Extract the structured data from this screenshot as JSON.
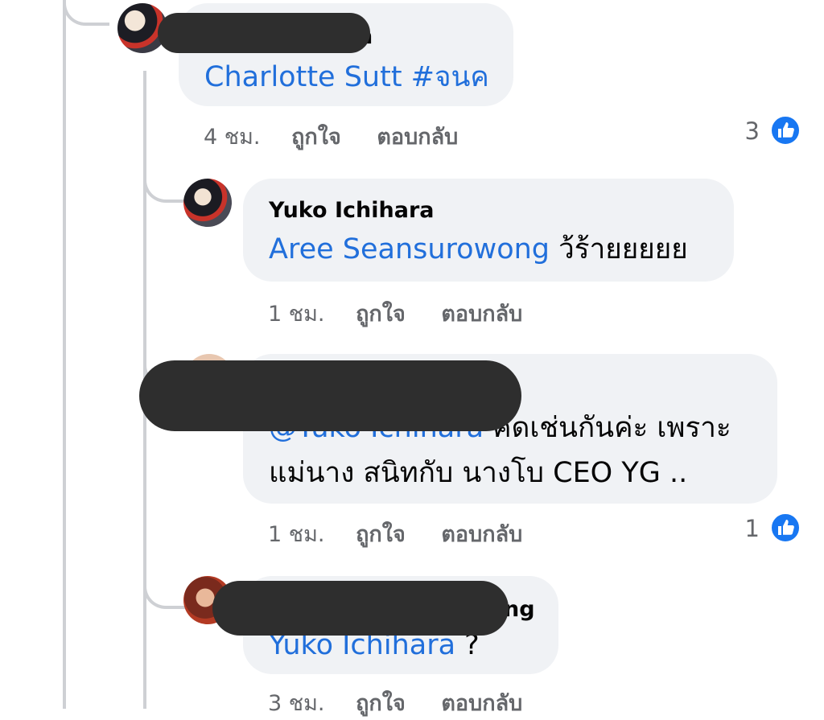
{
  "comments": [
    {
      "time": "4 ชม.",
      "like_label": "ถูกใจ",
      "reply_label": "ตอบกลับ",
      "author_visible": "n",
      "mention": "Charlotte Sutt #จนค",
      "reactions": "3"
    },
    {
      "author": "Yuko Ichihara",
      "mention": "Aree Seansurowong",
      "text": " ว้ร้ายยยยย",
      "time": "1 ชม.",
      "like_label": "ถูกใจ",
      "reply_label": "ตอบกลับ"
    },
    {
      "mention": "@Yuko Ichihara",
      "text_line1": " คิดเช่นกันค่ะ เพราะ",
      "text_line2": "แม่นาง สนิทกับ นางโบ CEO YG ..",
      "time": "1 ชม.",
      "like_label": "ถูกใจ",
      "reply_label": "ตอบกลับ",
      "reactions": "1"
    },
    {
      "author_visible": "ng",
      "mention": "Yuko Ichihara",
      "text": " ?",
      "time": "3 ชม.",
      "like_label": "ถูกใจ",
      "reply_label": "ตอบกลับ"
    }
  ],
  "colors": {
    "bubble": "#f0f2f5",
    "link": "#216fdb",
    "like_blue": "#1877f2",
    "thread_line": "#ced0d4",
    "redaction": "#2e2e2e"
  },
  "icons": [
    "like-thumb-icon"
  ]
}
